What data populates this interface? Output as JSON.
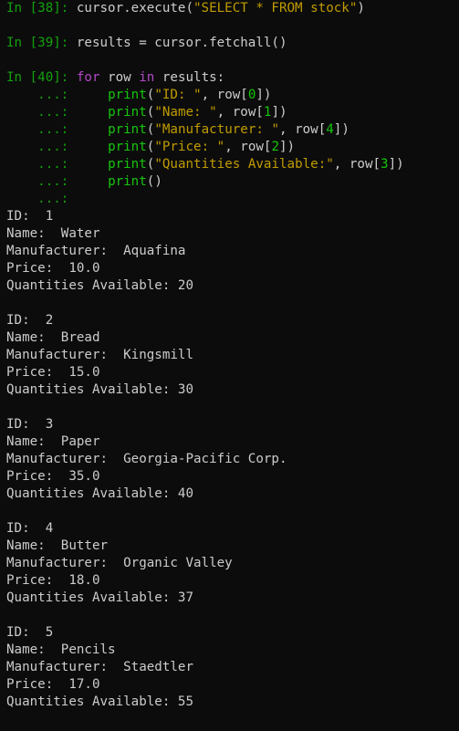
{
  "colors": {
    "background": "#0c0c0c",
    "text": "#cccccc",
    "prompt": "#13a10e",
    "keyword": "#b148c6",
    "builtin": "#16c60c",
    "string": "#c19c00",
    "number": "#16c60c"
  },
  "cells": [
    {
      "prompt": "In [38]:",
      "code": [
        [
          [
            "txt",
            " cursor.execute("
          ],
          [
            "str",
            "\"SELECT * FROM stock\""
          ],
          [
            "txt",
            ")"
          ]
        ]
      ]
    },
    {
      "prompt": "In [39]:",
      "code": [
        [
          [
            "txt",
            " results = cursor.fetchall()"
          ]
        ]
      ]
    },
    {
      "prompt": "In [40]:",
      "code": [
        [
          [
            "txt",
            " "
          ],
          [
            "kw",
            "for"
          ],
          [
            "txt",
            " row "
          ],
          [
            "kw",
            "in"
          ],
          [
            "txt",
            " results:"
          ]
        ]
      ],
      "continuation_prompt": "    ...:",
      "continuation": [
        [
          [
            "txt",
            "     "
          ],
          [
            "fn",
            "print"
          ],
          [
            "txt",
            "("
          ],
          [
            "str",
            "\"ID: \""
          ],
          [
            "txt",
            ", row["
          ],
          [
            "num",
            "0"
          ],
          [
            "txt",
            "])"
          ]
        ],
        [
          [
            "txt",
            "     "
          ],
          [
            "fn",
            "print"
          ],
          [
            "txt",
            "("
          ],
          [
            "str",
            "\"Name: \""
          ],
          [
            "txt",
            ", row["
          ],
          [
            "num",
            "1"
          ],
          [
            "txt",
            "])"
          ]
        ],
        [
          [
            "txt",
            "     "
          ],
          [
            "fn",
            "print"
          ],
          [
            "txt",
            "("
          ],
          [
            "str",
            "\"Manufacturer: \""
          ],
          [
            "txt",
            ", row["
          ],
          [
            "num",
            "4"
          ],
          [
            "txt",
            "])"
          ]
        ],
        [
          [
            "txt",
            "     "
          ],
          [
            "fn",
            "print"
          ],
          [
            "txt",
            "("
          ],
          [
            "str",
            "\"Price: \""
          ],
          [
            "txt",
            ", row["
          ],
          [
            "num",
            "2"
          ],
          [
            "txt",
            "])"
          ]
        ],
        [
          [
            "txt",
            "     "
          ],
          [
            "fn",
            "print"
          ],
          [
            "txt",
            "("
          ],
          [
            "str",
            "\"Quantities Available:\""
          ],
          [
            "txt",
            ", row["
          ],
          [
            "num",
            "3"
          ],
          [
            "txt",
            "])"
          ]
        ],
        [
          [
            "txt",
            "     "
          ],
          [
            "fn",
            "print"
          ],
          [
            "txt",
            "()"
          ]
        ],
        [
          [
            "txt",
            ""
          ]
        ]
      ]
    }
  ],
  "output_labels": {
    "id": "ID:  ",
    "name": "Name:  ",
    "manufacturer": "Manufacturer:  ",
    "price": "Price:  ",
    "quantity": "Quantities Available: "
  },
  "records": [
    {
      "id": "1",
      "name": "Water",
      "manufacturer": "Aquafina",
      "price": "10.0",
      "quantity": "20"
    },
    {
      "id": "2",
      "name": "Bread",
      "manufacturer": "Kingsmill",
      "price": "15.0",
      "quantity": "30"
    },
    {
      "id": "3",
      "name": "Paper",
      "manufacturer": "Georgia-Pacific Corp.",
      "price": "35.0",
      "quantity": "40"
    },
    {
      "id": "4",
      "name": "Butter",
      "manufacturer": "Organic Valley",
      "price": "18.0",
      "quantity": "37"
    },
    {
      "id": "5",
      "name": "Pencils",
      "manufacturer": "Staedtler",
      "price": "17.0",
      "quantity": "55"
    }
  ]
}
